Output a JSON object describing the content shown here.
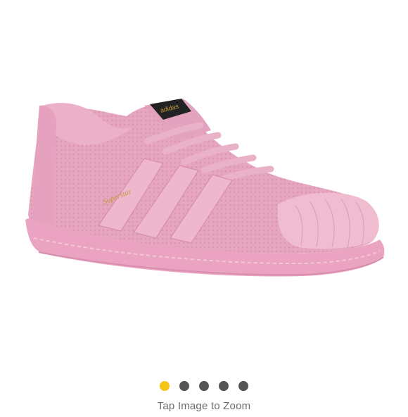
{
  "gallery": {
    "image_alt": "Pink adidas Superstar sneaker with textured upper and shell toe",
    "shoe_brand_mark": "adidas",
    "shoe_side_logo": "Superstar",
    "dots": [
      {
        "active": true
      },
      {
        "active": false
      },
      {
        "active": false
      },
      {
        "active": false
      },
      {
        "active": false
      }
    ],
    "hint_text": "Tap Image to Zoom"
  },
  "colors": {
    "shoe_pink": "#e9a9c3",
    "shoe_pink_light": "#f2c3d6",
    "shoe_pink_dark": "#d48aa8",
    "logo_gold": "#c69a3a",
    "dot_active": "#f3c514",
    "dot_inactive": "#555555"
  }
}
